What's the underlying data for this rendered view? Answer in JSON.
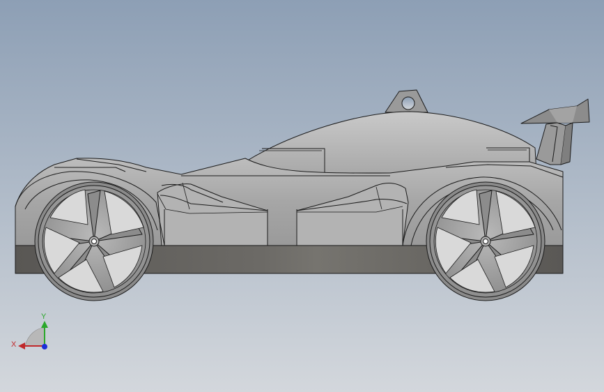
{
  "viewport": {
    "background_top": "#8d9fb5",
    "background_bottom": "#d3d7dc"
  },
  "model": {
    "body_color": "#a8a8a8",
    "body_light": "#c4c4c4",
    "skirt_color": "#5c5a57",
    "edge_color": "#1a1a1a",
    "rim_color": "#9a9a9a"
  },
  "triad": {
    "x_label": "X",
    "y_label": "Y",
    "x_color": "#c0282a",
    "y_color": "#2aa82a",
    "z_color": "#1c2fd8"
  }
}
